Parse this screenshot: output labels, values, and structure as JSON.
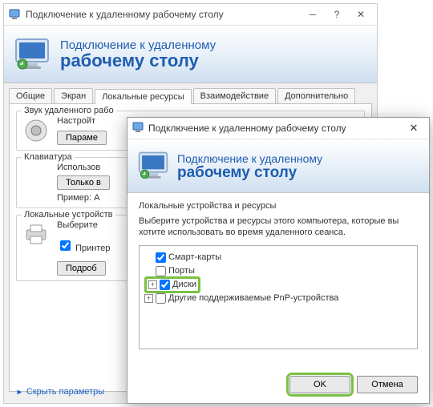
{
  "main": {
    "title": "Подключение к удаленному рабочему столу",
    "banner_line1": "Подключение к удаленному",
    "banner_line2": "рабочему столу",
    "tabs": {
      "t0": "Общие",
      "t1": "Экран",
      "t2": "Локальные ресурсы",
      "t3": "Взаимодействие",
      "t4": "Дополнительно"
    },
    "group_audio_title": "Звук удаленного рабо",
    "group_audio_desc": "Настройт",
    "group_audio_btn": "Параме",
    "group_kbd_title": "Клавиатура",
    "group_kbd_desc": "Использов",
    "group_kbd_btn": "Только в",
    "group_kbd_example": "Пример: A",
    "group_dev_title": "Локальные устройств",
    "group_dev_desc": "Выберите",
    "group_dev_printers": "Принтер",
    "group_dev_btn": "Подроб",
    "hide_params": "Скрыть параметры"
  },
  "dialog": {
    "title": "Подключение к удаленному рабочему столу",
    "banner_line1": "Подключение к удаленному",
    "banner_line2": "рабочему столу",
    "section": "Локальные устройства и ресурсы",
    "desc": "Выберите устройства и ресурсы этого компьютера, которые вы хотите использовать во время удаленного сеанса.",
    "tree": {
      "smart": "Смарт-карты",
      "ports": "Порты",
      "disks": "Диски",
      "pnp": "Другие поддерживаемые PnP-устройства"
    },
    "ok": "OK",
    "cancel": "Отмена"
  }
}
